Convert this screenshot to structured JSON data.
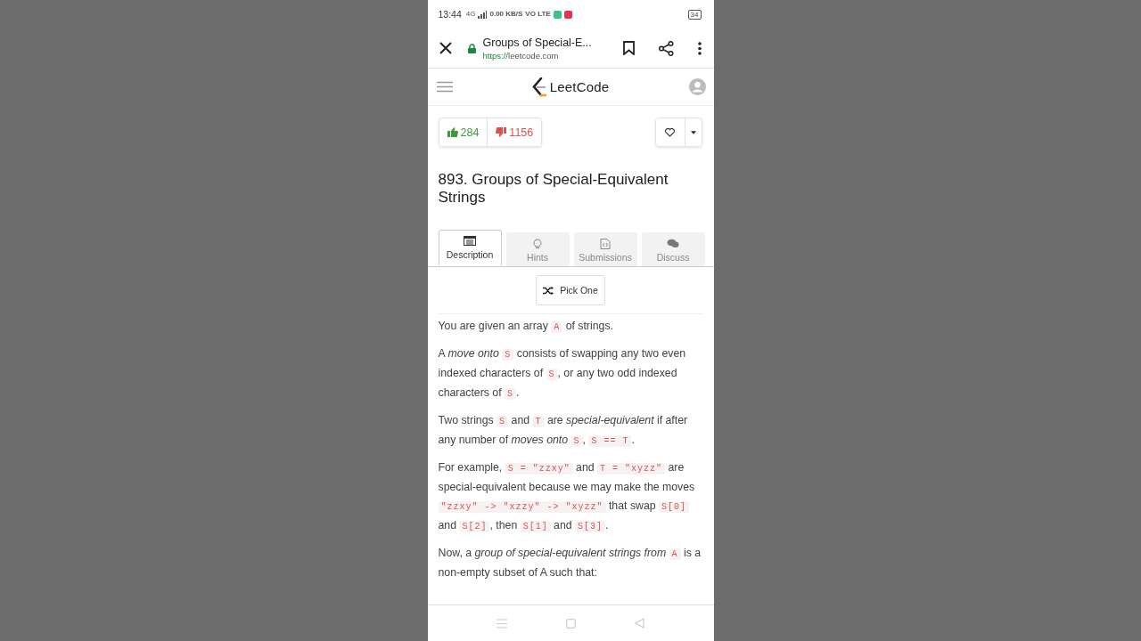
{
  "status_bar": {
    "time": "13:44",
    "network": "4G",
    "speed": "0.00 KB/S",
    "volte": "VO LTE",
    "battery": "34"
  },
  "browser": {
    "title": "Groups of Special-E...",
    "url_scheme": "https://",
    "url_host": "leetcode.com",
    "secure": true
  },
  "site_header": {
    "logo_text": "LeetCode"
  },
  "votes": {
    "likes": "284",
    "dislikes": "1156"
  },
  "problem": {
    "title": "893. Groups of Special-Equivalent Strings"
  },
  "tabs": [
    {
      "label": "Description",
      "selected": true
    },
    {
      "label": "Hints",
      "selected": false
    },
    {
      "label": "Submissions",
      "selected": false
    },
    {
      "label": "Discuss",
      "selected": false
    }
  ],
  "pick_button": {
    "label": "Pick One"
  },
  "paragraphs": [
    [
      {
        "kind": "text",
        "text": "You are given an array "
      },
      {
        "kind": "code",
        "text": "A"
      },
      {
        "kind": "text",
        "text": " of strings."
      }
    ],
    [
      {
        "kind": "text",
        "text": "A "
      },
      {
        "kind": "em",
        "text": "move onto "
      },
      {
        "kind": "code",
        "text": "S"
      },
      {
        "kind": "text",
        "text": " consists of swapping any two even indexed characters of "
      },
      {
        "kind": "code",
        "text": "S"
      },
      {
        "kind": "text",
        "text": ", or any two odd indexed characters of "
      },
      {
        "kind": "code",
        "text": "S"
      },
      {
        "kind": "text",
        "text": "."
      }
    ],
    [
      {
        "kind": "text",
        "text": "Two strings "
      },
      {
        "kind": "code",
        "text": "S"
      },
      {
        "kind": "text",
        "text": " and "
      },
      {
        "kind": "code",
        "text": "T"
      },
      {
        "kind": "text",
        "text": " are "
      },
      {
        "kind": "em",
        "text": "special-equivalent"
      },
      {
        "kind": "text",
        "text": " if after any number of "
      },
      {
        "kind": "em",
        "text": "moves onto "
      },
      {
        "kind": "code",
        "text": "S"
      },
      {
        "kind": "text",
        "text": ", "
      },
      {
        "kind": "code",
        "text": "S == T"
      },
      {
        "kind": "text",
        "text": "."
      }
    ],
    [
      {
        "kind": "text",
        "text": "For example, "
      },
      {
        "kind": "code",
        "text": "S = \"zzxy\""
      },
      {
        "kind": "text",
        "text": " and "
      },
      {
        "kind": "code",
        "text": "T = \"xyzz\""
      },
      {
        "kind": "text",
        "text": " are special-equivalent because we may make the moves "
      },
      {
        "kind": "code",
        "text": "\"zzxy\" -> \"xzzy\" -> \"xyzz\""
      },
      {
        "kind": "text",
        "text": " that swap "
      },
      {
        "kind": "code",
        "text": "S[0]"
      },
      {
        "kind": "text",
        "text": " and "
      },
      {
        "kind": "code",
        "text": "S[2]"
      },
      {
        "kind": "text",
        "text": ", then "
      },
      {
        "kind": "code",
        "text": "S[1]"
      },
      {
        "kind": "text",
        "text": " and "
      },
      {
        "kind": "code",
        "text": "S[3]"
      },
      {
        "kind": "text",
        "text": "."
      }
    ],
    [
      {
        "kind": "text",
        "text": "Now, a "
      },
      {
        "kind": "em",
        "text": "group of special-equivalent strings from "
      },
      {
        "kind": "code",
        "text": "A"
      },
      {
        "kind": "text",
        "text": " is a non-empty subset of A such that:"
      }
    ]
  ]
}
